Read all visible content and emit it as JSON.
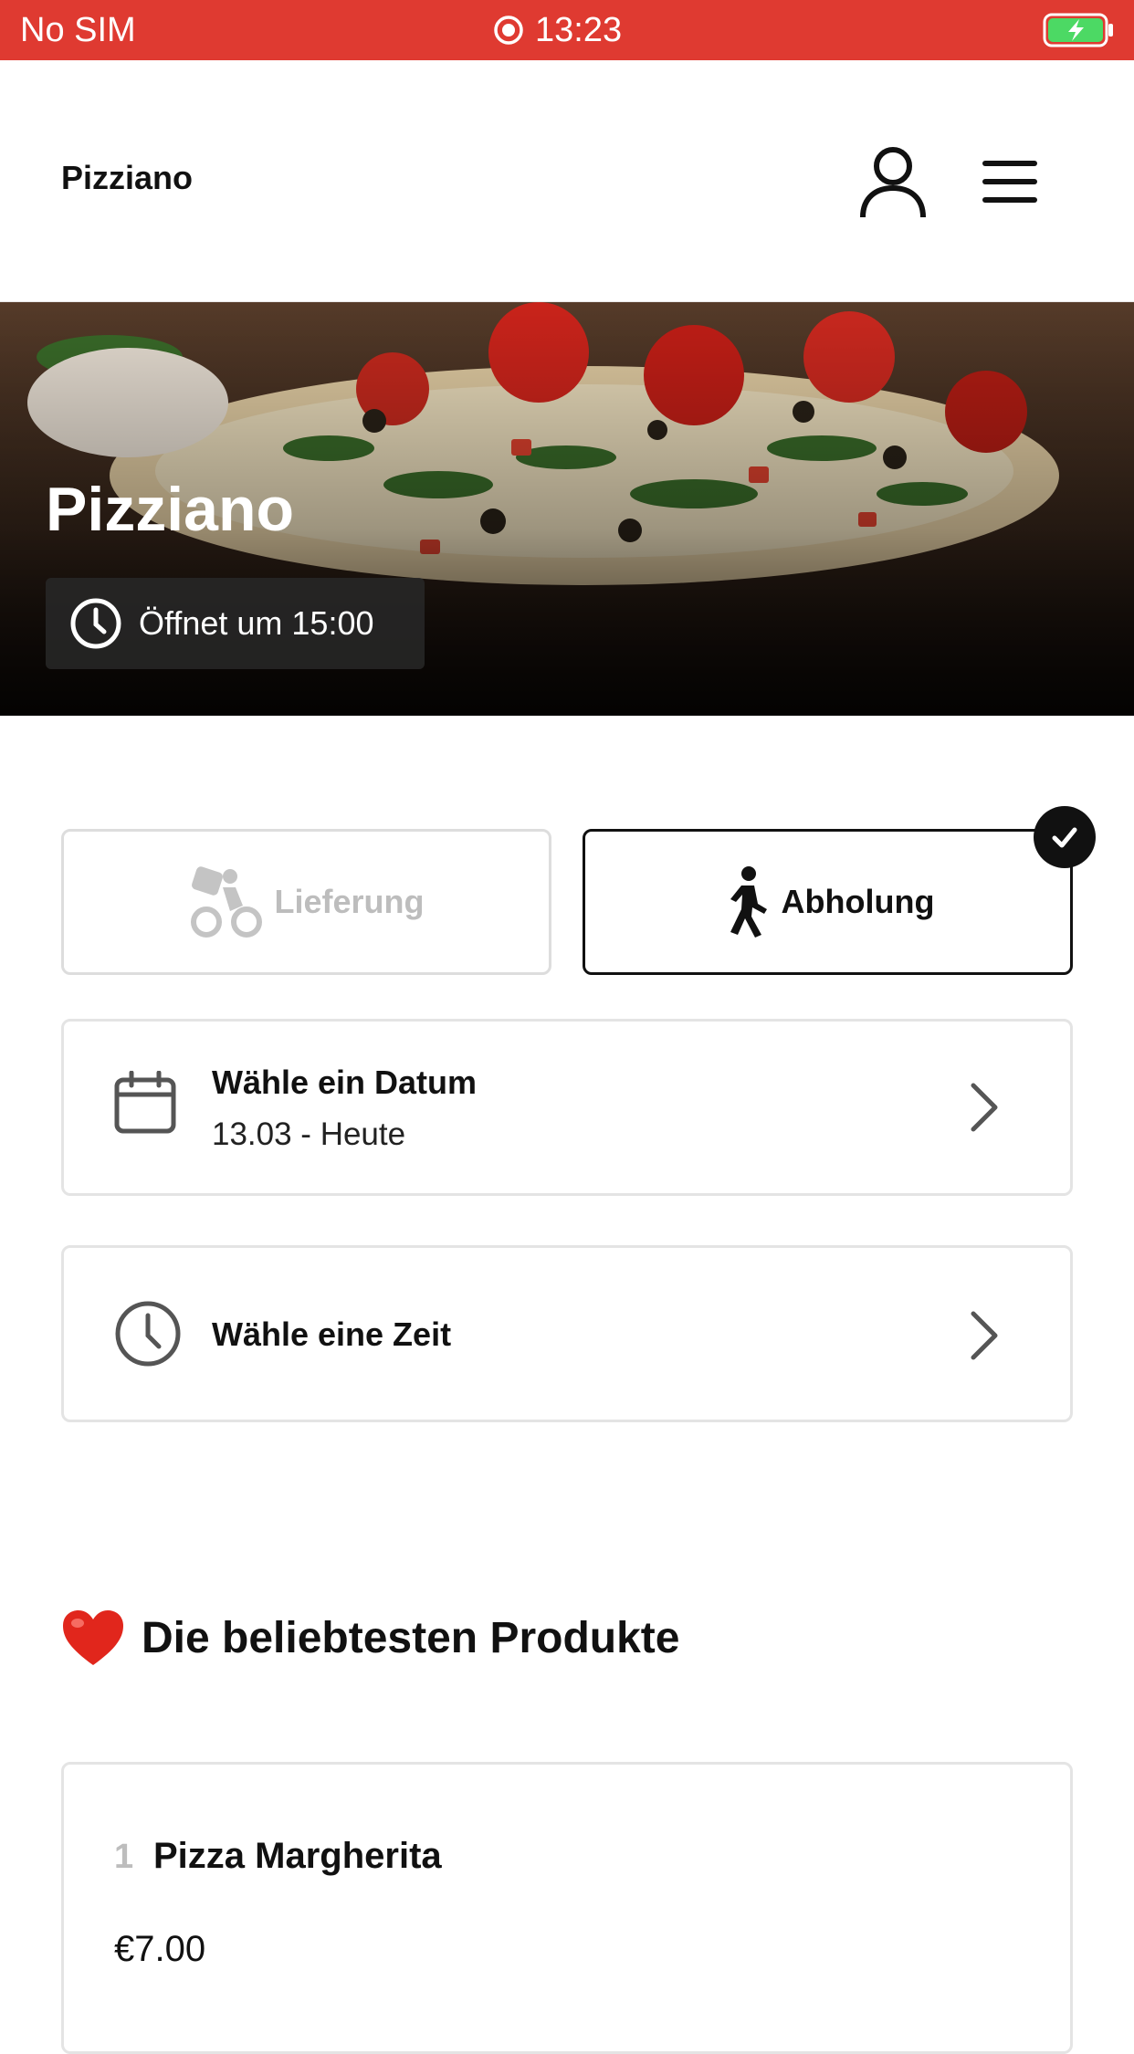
{
  "status_bar": {
    "carrier": "No SIM",
    "time": "13:23",
    "bg_color": "#df3a31"
  },
  "header": {
    "brand": "Pizziano",
    "account_icon": "user-icon",
    "menu_icon": "hamburger-menu-icon"
  },
  "hero": {
    "title": "Pizziano",
    "hours": "Öffnet um 15:00",
    "hours_icon": "clock-icon"
  },
  "order_type": {
    "options": [
      {
        "label": "Lieferung",
        "icon": "bike-delivery-icon",
        "selected": false
      },
      {
        "label": "Abholung",
        "icon": "walking-person-icon",
        "selected": true
      }
    ]
  },
  "date_row": {
    "title": "Wähle ein Datum",
    "value": "13.03 - Heute",
    "icon": "calendar-icon"
  },
  "time_row": {
    "title": "Wähle eine Zeit",
    "icon": "clock-icon"
  },
  "popular": {
    "emoji": "❤️",
    "title": "Die beliebtesten Produkte",
    "products": [
      {
        "rank": "1",
        "name": "Pizza Margherita",
        "price": "€7.00"
      }
    ]
  }
}
